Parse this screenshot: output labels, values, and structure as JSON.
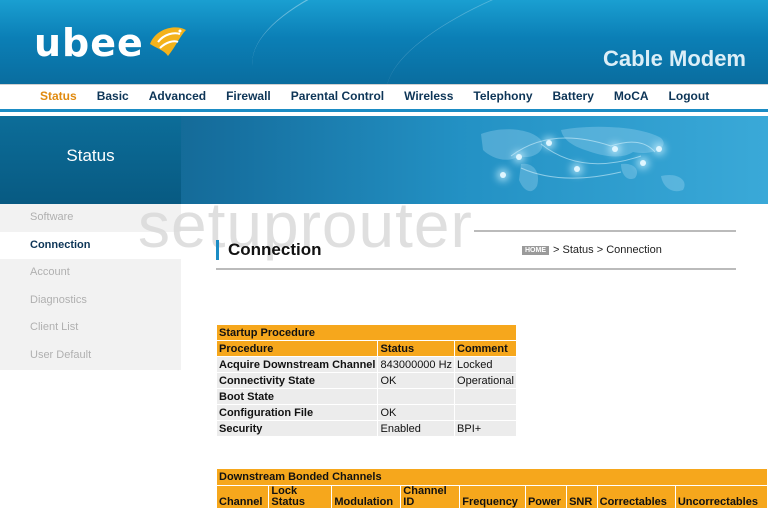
{
  "brand": {
    "logo_text": "ubee",
    "product": "Cable Modem"
  },
  "nav": {
    "items": [
      {
        "label": "Status",
        "active": true
      },
      {
        "label": "Basic"
      },
      {
        "label": "Advanced"
      },
      {
        "label": "Firewall"
      },
      {
        "label": "Parental Control"
      },
      {
        "label": "Wireless"
      },
      {
        "label": "Telephony"
      },
      {
        "label": "Battery"
      },
      {
        "label": "MoCA"
      },
      {
        "label": "Logout"
      }
    ]
  },
  "banner": {
    "title": "Status"
  },
  "sidebar": {
    "items": [
      {
        "label": "Software"
      },
      {
        "label": "Connection",
        "active": true
      },
      {
        "label": "Account"
      },
      {
        "label": "Diagnostics"
      },
      {
        "label": "Client List"
      },
      {
        "label": "User Default"
      }
    ]
  },
  "watermark": "setuprouter",
  "page": {
    "title": "Connection",
    "breadcrumb": {
      "home": "HOME",
      "path": "> Status > Connection"
    }
  },
  "startup": {
    "caption": "Startup Procedure",
    "headers": [
      "Procedure",
      "Status",
      "Comment"
    ],
    "rows": [
      [
        "Acquire Downstream Channel",
        "843000000 Hz",
        "Locked"
      ],
      [
        "Connectivity State",
        "OK",
        "Operational"
      ],
      [
        "Boot State",
        "",
        ""
      ],
      [
        "Configuration File",
        "OK",
        ""
      ],
      [
        "Security",
        "Enabled",
        "BPI+"
      ]
    ]
  },
  "downstream": {
    "caption": "Downstream Bonded Channels",
    "headers": [
      "Channel",
      "Lock Status",
      "Modulation",
      "Channel ID",
      "Frequency",
      "Power",
      "SNR",
      "Correctables",
      "Uncorrectables"
    ]
  },
  "colors": {
    "accent": "#f6a71c",
    "nav_active": "#e08a0f",
    "brand_blue": "#1b8cc4"
  }
}
